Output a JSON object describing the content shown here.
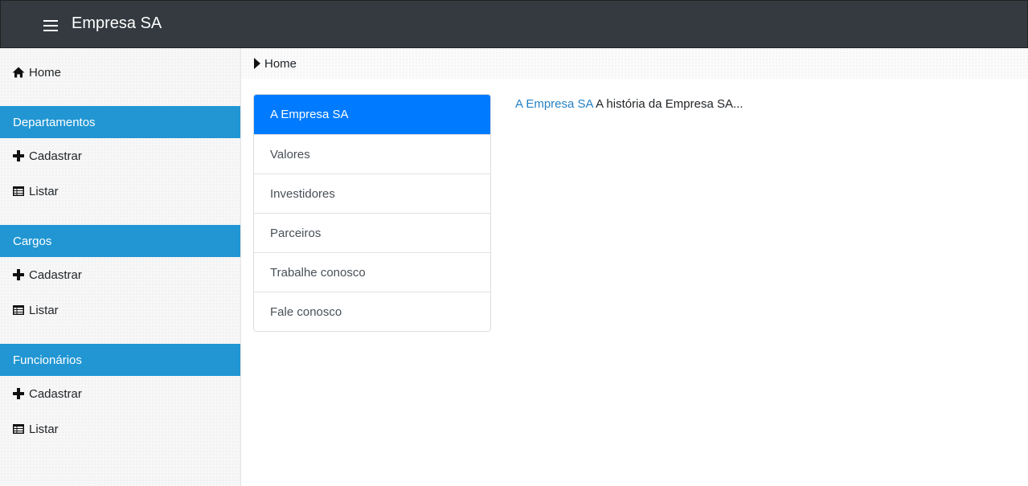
{
  "header": {
    "brand": "Empresa SA",
    "menu_icon": "hamburger-icon",
    "bg_color": "#343a40"
  },
  "sidebar": {
    "home": {
      "label": "Home",
      "icon": "home-icon"
    },
    "sections": [
      {
        "title": "Departamentos",
        "items": [
          {
            "label": "Cadastrar",
            "icon": "plus-icon"
          },
          {
            "label": "Listar",
            "icon": "table-icon"
          }
        ]
      },
      {
        "title": "Cargos",
        "items": [
          {
            "label": "Cadastrar",
            "icon": "plus-icon"
          },
          {
            "label": "Listar",
            "icon": "table-icon"
          }
        ]
      },
      {
        "title": "Funcionários",
        "items": [
          {
            "label": "Cadastrar",
            "icon": "plus-icon"
          },
          {
            "label": "Listar",
            "icon": "table-icon"
          }
        ]
      }
    ],
    "header_color": "#2196d3"
  },
  "breadcrumb": {
    "label": "Home",
    "icon": "caret-right-icon"
  },
  "menu": {
    "items": [
      {
        "label": "A Empresa SA",
        "active": true
      },
      {
        "label": "Valores",
        "active": false
      },
      {
        "label": "Investidores",
        "active": false
      },
      {
        "label": "Parceiros",
        "active": false
      },
      {
        "label": "Trabalhe conosco",
        "active": false
      },
      {
        "label": "Fale conosco",
        "active": false
      }
    ],
    "active_color": "#007bff"
  },
  "content": {
    "link": "A Empresa SA",
    "text": "A história da Empresa SA..."
  }
}
